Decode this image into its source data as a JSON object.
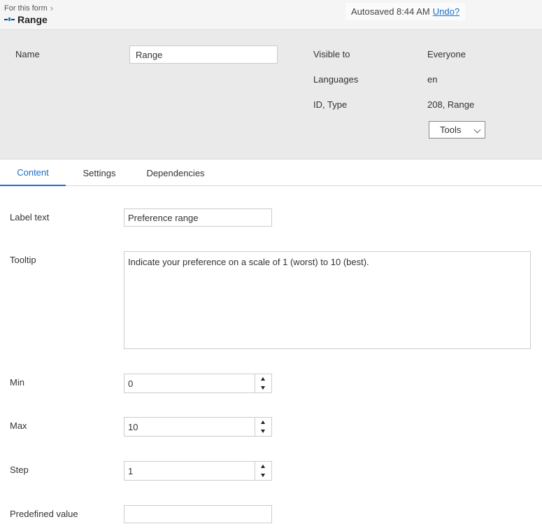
{
  "header": {
    "breadcrumb": "For this form",
    "title": "Range",
    "icon": "range-icon",
    "autosave_text": "Autosaved 8:44 AM",
    "undo_label": "Undo?"
  },
  "properties": {
    "name_label": "Name",
    "name_value": "Range",
    "visible_to_label": "Visible to",
    "visible_to_value": "Everyone",
    "languages_label": "Languages",
    "languages_value": "en",
    "id_type_label": "ID, Type",
    "id_type_value": "208, Range",
    "tools_label": "Tools"
  },
  "tabs": [
    {
      "label": "Content",
      "active": true
    },
    {
      "label": "Settings",
      "active": false
    },
    {
      "label": "Dependencies",
      "active": false
    }
  ],
  "form": {
    "label_text": {
      "label": "Label text",
      "value": "Preference range"
    },
    "tooltip": {
      "label": "Tooltip",
      "value": "Indicate your preference on a scale of 1 (worst) to 10 (best)."
    },
    "min": {
      "label": "Min",
      "value": "0"
    },
    "max": {
      "label": "Max",
      "value": "10"
    },
    "step": {
      "label": "Step",
      "value": "1"
    },
    "predefined": {
      "label": "Predefined value",
      "value": ""
    }
  },
  "colors": {
    "accent": "#1a6ec9",
    "panel_bg": "#eaeaea",
    "topbar_bg": "#f5f5f5"
  }
}
